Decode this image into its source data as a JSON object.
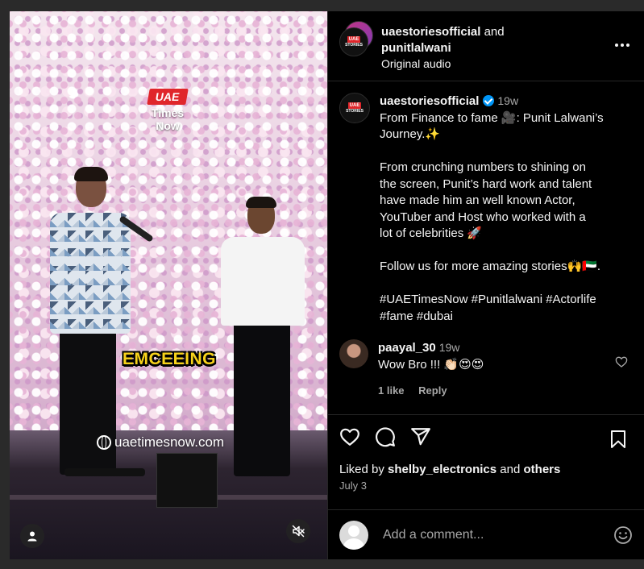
{
  "header": {
    "account1": "uaestoriesofficial",
    "conjunction": "and",
    "account2": "punitlalwani",
    "audio": "Original audio",
    "avatar_top": "UAE",
    "avatar_bottom": "STORIES"
  },
  "video": {
    "logo_top": "UAE",
    "logo_bottom": "Times Now",
    "overlay_caption": "EMCEEING",
    "watermark": "uaetimesnow.com"
  },
  "post": {
    "username": "uaestoriesofficial",
    "time": "19w",
    "caption_lines": [
      "From Finance to fame 🎥: Punit Lalwani’s",
      "Journey.✨",
      "",
      "From crunching numbers to shining on",
      "the screen, Punit’s hard work and talent",
      "have made him an well known Actor,",
      "YouTuber and Host who worked with a",
      "lot of celebrities 🚀",
      "",
      "Follow us for more amazing stories🙌🇦🇪.",
      "",
      "#UAETimesNow #Punitlalwani #Actorlife",
      "#fame #dubai"
    ]
  },
  "comment": {
    "username": "paayal_30",
    "time": "19w",
    "text": "Wow Bro !!! 👏🏻😍😍",
    "likes": "1 like",
    "reply": "Reply"
  },
  "likes": {
    "prefix": "Liked by",
    "user": "shelby_electronics",
    "and": "and",
    "others": "others"
  },
  "date": "July 3",
  "add_comment": {
    "placeholder": "Add a comment..."
  },
  "icons": {
    "like": "heart-icon",
    "comment": "comment-icon",
    "share": "share-icon",
    "save": "bookmark-icon",
    "more": "more-icon",
    "mute": "mute-icon",
    "tag": "user-tag-icon",
    "emoji": "emoji-icon"
  },
  "colors": {
    "background": "#000000",
    "verified": "#0095f6",
    "muted_text": "#a8a8a8",
    "brand_red": "#e0262b"
  }
}
